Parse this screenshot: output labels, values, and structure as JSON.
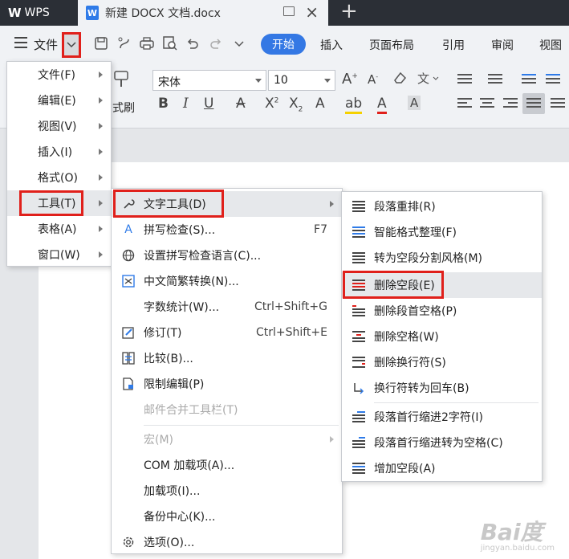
{
  "app": {
    "brand": "WPS",
    "doc_tab": "新建 DOCX 文档.docx",
    "new_tab_glyph": "+"
  },
  "ribbon": {
    "file_label": "文件",
    "tabs": [
      "开始",
      "插入",
      "页面布局",
      "引用",
      "审阅",
      "视图"
    ],
    "font_name": "宋体",
    "font_size": "10",
    "format_painter_label": "式刷"
  },
  "file_menu": {
    "items": [
      {
        "label": "文件(F)"
      },
      {
        "label": "编辑(E)"
      },
      {
        "label": "视图(V)"
      },
      {
        "label": "插入(I)"
      },
      {
        "label": "格式(O)"
      },
      {
        "label": "工具(T)"
      },
      {
        "label": "表格(A)"
      },
      {
        "label": "窗口(W)"
      }
    ]
  },
  "tools_menu": {
    "items": [
      {
        "label": "文字工具(D)",
        "shortcut": ""
      },
      {
        "label": "拼写检查(S)...",
        "shortcut": "F7"
      },
      {
        "label": "设置拼写检查语言(C)...",
        "shortcut": ""
      },
      {
        "label": "中文简繁转换(N)...",
        "shortcut": ""
      },
      {
        "label": "字数统计(W)...",
        "shortcut": "Ctrl+Shift+G"
      },
      {
        "label": "修订(T)",
        "shortcut": "Ctrl+Shift+E"
      },
      {
        "label": "比较(B)...",
        "shortcut": ""
      },
      {
        "label": "限制编辑(P)",
        "shortcut": ""
      },
      {
        "label": "邮件合并工具栏(T)",
        "shortcut": ""
      },
      {
        "label": "宏(M)",
        "shortcut": ""
      },
      {
        "label": "COM 加载项(A)...",
        "shortcut": ""
      },
      {
        "label": "加载项(I)...",
        "shortcut": ""
      },
      {
        "label": "备份中心(K)...",
        "shortcut": ""
      },
      {
        "label": "选项(O)...",
        "shortcut": ""
      }
    ]
  },
  "text_tools_menu": {
    "items": [
      {
        "label": "段落重排(R)"
      },
      {
        "label": "智能格式整理(F)"
      },
      {
        "label": "转为空段分割风格(M)"
      },
      {
        "label": "删除空段(E)"
      },
      {
        "label": "删除段首空格(P)"
      },
      {
        "label": "删除空格(W)"
      },
      {
        "label": "删除换行符(S)"
      },
      {
        "label": "换行符转为回车(B)"
      },
      {
        "label": "段落首行缩进2字符(I)"
      },
      {
        "label": "段落首行缩进转为空格(C)"
      },
      {
        "label": "增加空段(A)"
      }
    ]
  },
  "watermark": {
    "logo": "Bai度",
    "url": "jingyan.baidu.com"
  },
  "colors": {
    "accent": "#3478e4",
    "highlight_box": "#e0201b",
    "tabbar": "#2b2f36"
  }
}
